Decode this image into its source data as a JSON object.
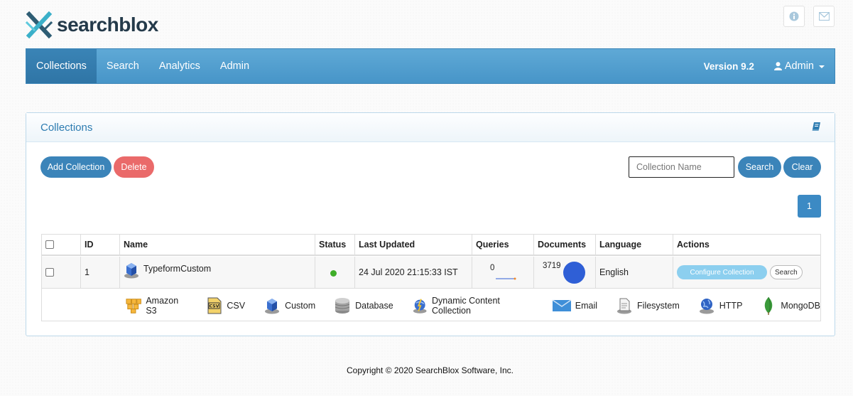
{
  "header": {
    "brand": "searchblox",
    "icons": [
      "info-icon",
      "envelope-icon"
    ]
  },
  "nav": {
    "items": [
      {
        "label": "Collections",
        "active": true
      },
      {
        "label": "Search"
      },
      {
        "label": "Analytics"
      },
      {
        "label": "Admin"
      }
    ],
    "version": "Version 9.2",
    "user": "Admin"
  },
  "panel": {
    "title": "Collections",
    "add_label": "Add Collection",
    "delete_label": "Delete",
    "search_placeholder": "Collection Name",
    "search_label": "Search",
    "clear_label": "Clear",
    "page": "1"
  },
  "table": {
    "headers": [
      "ID",
      "Name",
      "Status",
      "Last Updated",
      "Queries",
      "Documents",
      "Language",
      "Actions"
    ],
    "rows": [
      {
        "id": "1",
        "name": "TypeformCustom",
        "status": "active",
        "last_updated": "24 Jul 2020 21:15:33 IST",
        "queries": "0",
        "documents": "3719",
        "language": "English",
        "configure_label": "Configure Collection",
        "search_label": "Search"
      }
    ]
  },
  "legend": [
    {
      "label": "Amazon S3",
      "icon": "amazon-s3-icon"
    },
    {
      "label": "CSV",
      "icon": "csv-icon"
    },
    {
      "label": "Custom",
      "icon": "custom-icon"
    },
    {
      "label": "Database",
      "icon": "database-icon"
    },
    {
      "label": "Dynamic Content Collection",
      "icon": "dynamic-content-icon"
    },
    {
      "label": "Email",
      "icon": "email-icon"
    },
    {
      "label": "Filesystem",
      "icon": "filesystem-icon"
    },
    {
      "label": "HTTP",
      "icon": "http-icon"
    },
    {
      "label": "MongoDB",
      "icon": "mongodb-icon"
    }
  ],
  "colors": {
    "navbar": "#4f9fd0",
    "primary_button": "#3b84b9",
    "delete_button": "#ea6a6a",
    "status_active": "#3fae29"
  },
  "footer": "Copyright © 2020 SearchBlox Software, Inc."
}
